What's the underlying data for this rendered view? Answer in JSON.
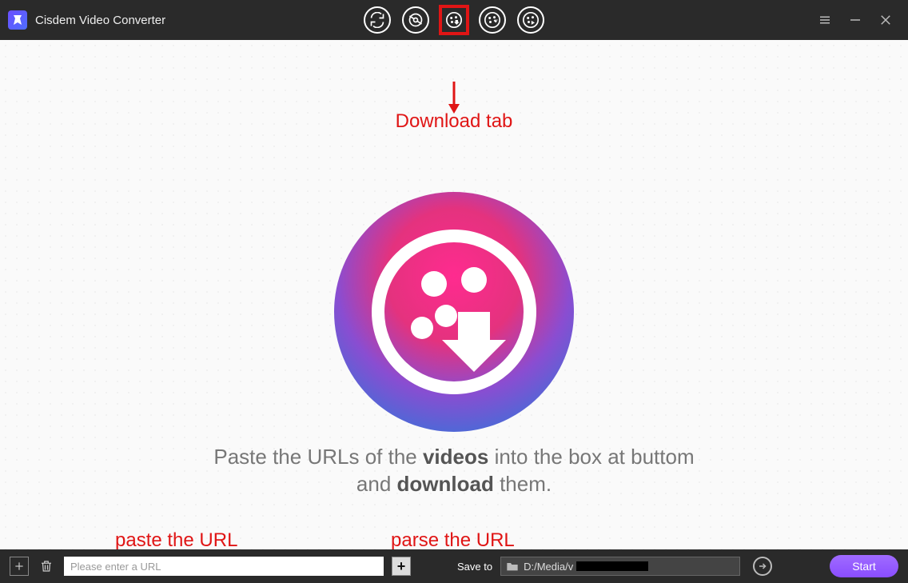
{
  "title": "Cisdem Video Converter",
  "annotations": {
    "download_tab": "Download tab",
    "paste_url": "paste the URL",
    "parse_url": "parse the URL"
  },
  "instructions": {
    "line1_a": "Paste the URLs of the ",
    "line1_b": "videos",
    "line1_c": " into the box at buttom",
    "line2_a": "and ",
    "line2_b": "download",
    "line2_c": " them."
  },
  "footer": {
    "url_placeholder": "Please enter a URL",
    "save_to_label": "Save to",
    "save_path": "D:/Media/v",
    "start_label": "Start"
  }
}
